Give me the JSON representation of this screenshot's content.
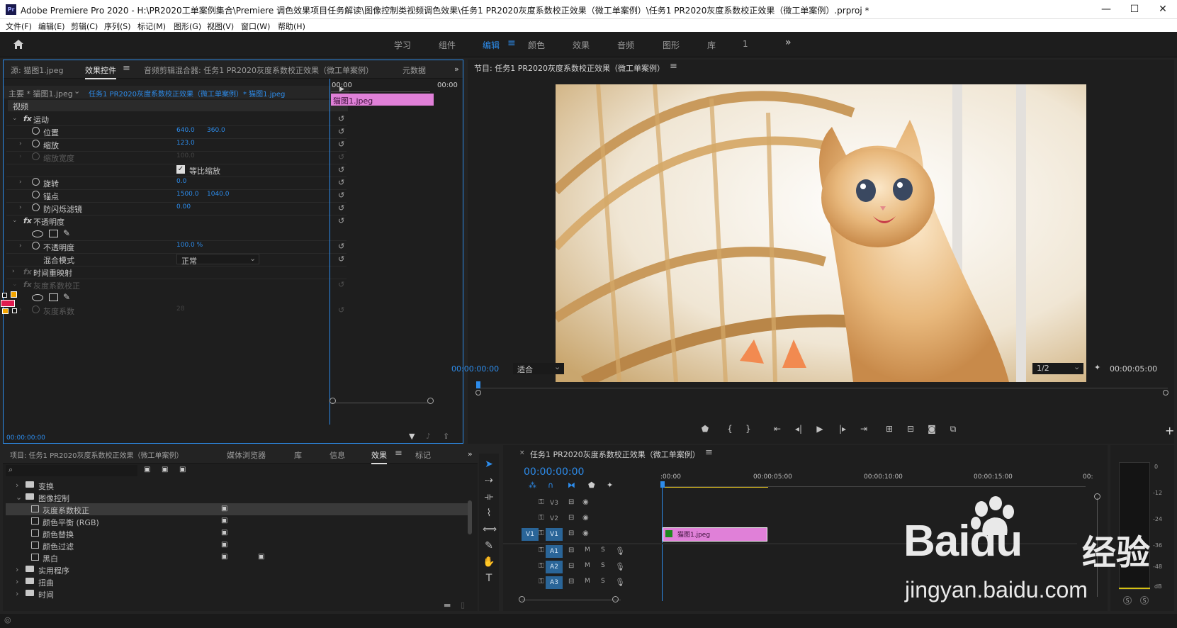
{
  "app": {
    "title": "Adobe Premiere Pro 2020 - H:\\PR2020工单案例集合\\Premiere 调色效果项目任务解读\\图像控制类视频调色效果\\任务1 PR2020灰度系数校正效果（微工单案例）\\任务1 PR2020灰度系数校正效果（微工单案例）.prproj *",
    "badge": "Pr",
    "win_min": "—",
    "win_max": "☐",
    "win_close": "✕"
  },
  "menu": [
    "文件(F)",
    "编辑(E)",
    "剪辑(C)",
    "序列(S)",
    "标记(M)",
    "图形(G)",
    "视图(V)",
    "窗口(W)",
    "帮助(H)"
  ],
  "workspaces": {
    "items": [
      "学习",
      "组件",
      "编辑",
      "颜色",
      "效果",
      "音频",
      "图形",
      "库",
      "1"
    ],
    "active": "编辑",
    "more": "»",
    "home_icon": "home-icon"
  },
  "source_panel": {
    "tabs": [
      "源: 猫图1.jpeg",
      "效果控件",
      "音频剪辑混合器: 任务1 PR2020灰度系数校正效果（微工单案例）",
      "元数据"
    ],
    "active_tab": "效果控件",
    "more": "»",
    "master_label": "主要 * 猫图1.jpeg",
    "sequence_label": "任务1 PR2020灰度系数校正效果（微工单案例）* 猫图1.jpeg",
    "time_start": "00:00",
    "time_end": "00:00",
    "clip_name": "猫图1.jpeg",
    "video_label": "视频",
    "motion": {
      "name": "运动",
      "position_label": "位置",
      "position_x": "640.0",
      "position_y": "360.0",
      "scale_label": "缩放",
      "scale_value": "123.0",
      "scale_width_label": "缩放宽度",
      "scale_width_value": "100.0",
      "uniform_label": "等比缩放",
      "rotation_label": "旋转",
      "rotation_value": "0.0",
      "anchor_label": "锚点",
      "anchor_x": "1500.0",
      "anchor_y": "1040.0",
      "flicker_label": "防闪烁滤镜",
      "flicker_value": "0.00"
    },
    "opacity": {
      "name": "不透明度",
      "opacity_label": "不透明度",
      "opacity_value": "100.0 %",
      "blend_label": "混合模式",
      "blend_value": "正常"
    },
    "time_remap": "时间重映射",
    "gamma": {
      "name": "灰度系数校正",
      "param_label": "灰度系数",
      "param_value": "28"
    },
    "fx_label": "fx",
    "footer_time": "00:00:00:00"
  },
  "program_monitor": {
    "title": "节目: 任务1 PR2020灰度系数校正效果（微工单案例）",
    "timecode": "00:00:00:00",
    "fit": "适合",
    "resolution": "1/2",
    "duration": "00:00:05:00"
  },
  "project_panel": {
    "tabs": [
      "项目: 任务1 PR2020灰度系数校正效果（微工单案例）",
      "媒体浏览器",
      "库",
      "信息",
      "效果",
      "标记"
    ],
    "active_tab": "效果",
    "more": "»",
    "tree": [
      {
        "label": "变换",
        "type": "folder",
        "open": false,
        "indent": 0
      },
      {
        "label": "图像控制",
        "type": "folder",
        "open": true,
        "indent": 0
      },
      {
        "label": "灰度系数校正",
        "type": "effect",
        "indent": 1,
        "selected": true
      },
      {
        "label": "颜色平衡 (RGB)",
        "type": "effect",
        "indent": 1
      },
      {
        "label": "颜色替换",
        "type": "effect",
        "indent": 1
      },
      {
        "label": "颜色过滤",
        "type": "effect",
        "indent": 1
      },
      {
        "label": "黑白",
        "type": "effect",
        "indent": 1,
        "extra": true
      },
      {
        "label": "实用程序",
        "type": "folder",
        "open": false,
        "indent": 0
      },
      {
        "label": "扭曲",
        "type": "folder",
        "open": false,
        "indent": 0
      },
      {
        "label": "时间",
        "type": "folder",
        "open": false,
        "indent": 0
      }
    ]
  },
  "timeline": {
    "title": "任务1 PR2020灰度系数校正效果（微工单案例）",
    "timecode": "00:00:00:00",
    "ruler": [
      ":00:00",
      "00:00:05:00",
      "00:00:10:00",
      "00:00:15:00",
      "00:"
    ],
    "video_tracks": [
      {
        "name": "V3",
        "src": ""
      },
      {
        "name": "V2",
        "src": ""
      },
      {
        "name": "V1",
        "src": "V1"
      }
    ],
    "audio_tracks": [
      "A1",
      "A2",
      "A3"
    ],
    "m": "M",
    "s": "S",
    "clip_name": "猫图1.jpeg"
  },
  "meter": {
    "scale": [
      "0",
      "-12",
      "-24",
      "-36",
      "-48",
      "dB"
    ],
    "solo_left": "S",
    "solo_right": "S"
  },
  "watermark": {
    "brand": "Baidu",
    "product": "经验",
    "url": "jingyan.baidu.com"
  },
  "colors": {
    "accent": "#2d8ceb",
    "clip": "#e080d8",
    "track_target": "#2a6598"
  }
}
